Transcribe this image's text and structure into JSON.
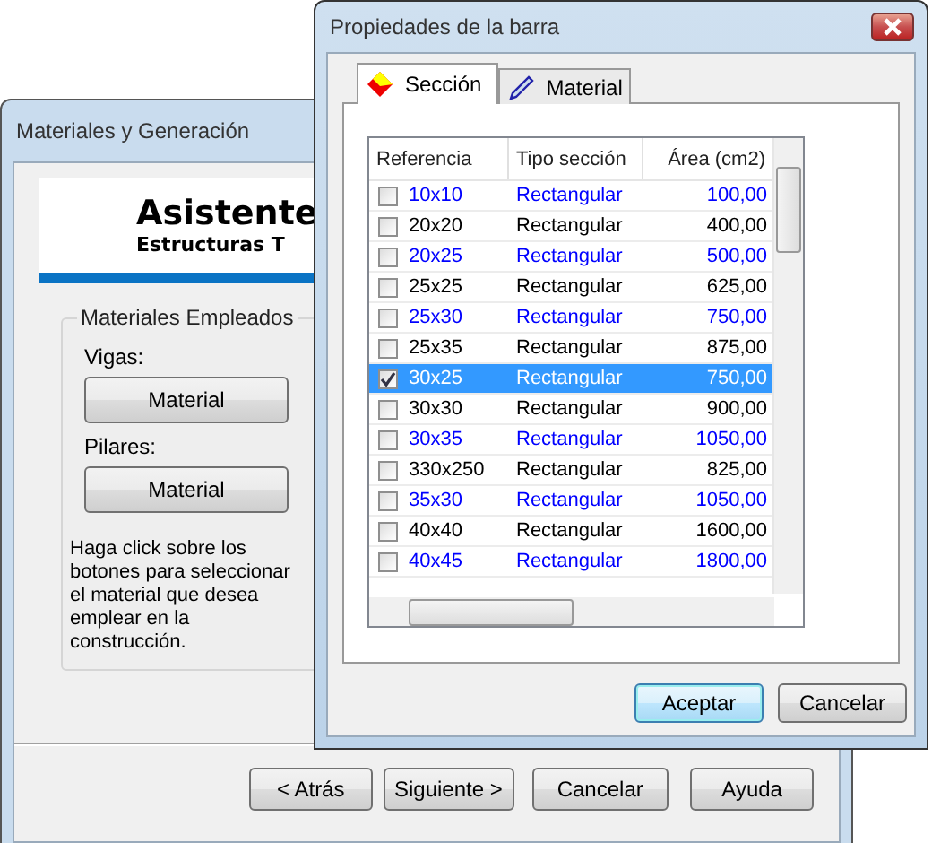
{
  "back_window": {
    "title": "Materiales y Generación",
    "banner": {
      "title": "Asistente",
      "subtitle": "Estructuras T"
    },
    "group": {
      "label": "Materiales Empleados",
      "fields": [
        {
          "label": "Vigas:",
          "button": "Material"
        },
        {
          "label": "Pilares:",
          "button": "Material"
        }
      ],
      "hint": "Haga click sobre los botones para seleccionar el material que desea emplear en la construcción."
    },
    "buttons": [
      {
        "label": "< Atrás",
        "default": false
      },
      {
        "label": "Siguiente >",
        "default": false
      },
      {
        "label": "Cancelar",
        "default": false
      },
      {
        "label": "Ayuda",
        "default": false
      }
    ]
  },
  "dialog": {
    "title": "Propiedades de la barra",
    "tabs": [
      {
        "label": "Sección",
        "selected": true,
        "kind": "section"
      },
      {
        "label": "Material",
        "selected": false,
        "kind": "material"
      }
    ],
    "table": {
      "columns": [
        "Referencia",
        "Tipo sección",
        "Área (cm2)"
      ],
      "rows": [
        {
          "ref": "10x10",
          "type": "Rectangular",
          "area": "100,00",
          "checked": false,
          "selected": false,
          "color": "#0000ff"
        },
        {
          "ref": "20x20",
          "type": "Rectangular",
          "area": "400,00",
          "checked": false,
          "selected": false,
          "color": "#000000"
        },
        {
          "ref": "20x25",
          "type": "Rectangular",
          "area": "500,00",
          "checked": false,
          "selected": false,
          "color": "#0000ff"
        },
        {
          "ref": "25x25",
          "type": "Rectangular",
          "area": "625,00",
          "checked": false,
          "selected": false,
          "color": "#000000"
        },
        {
          "ref": "25x30",
          "type": "Rectangular",
          "area": "750,00",
          "checked": false,
          "selected": false,
          "color": "#0000ff"
        },
        {
          "ref": "25x35",
          "type": "Rectangular",
          "area": "875,00",
          "checked": false,
          "selected": false,
          "color": "#000000"
        },
        {
          "ref": "30x25",
          "type": "Rectangular",
          "area": "750,00",
          "checked": true,
          "selected": true
        },
        {
          "ref": "30x30",
          "type": "Rectangular",
          "area": "900,00",
          "checked": false,
          "selected": false,
          "color": "#000000"
        },
        {
          "ref": "30x35",
          "type": "Rectangular",
          "area": "1050,00",
          "checked": false,
          "selected": false,
          "color": "#0000ff"
        },
        {
          "ref": "330x250",
          "type": "Rectangular",
          "area": "825,00",
          "checked": false,
          "selected": false,
          "color": "#000000"
        },
        {
          "ref": "35x30",
          "type": "Rectangular",
          "area": "1050,00",
          "checked": false,
          "selected": false,
          "color": "#0000ff"
        },
        {
          "ref": "40x40",
          "type": "Rectangular",
          "area": "1600,00",
          "checked": false,
          "selected": false,
          "color": "#000000"
        },
        {
          "ref": "40x45",
          "type": "Rectangular",
          "area": "1800,00",
          "checked": false,
          "selected": false,
          "color": "#0000ff"
        }
      ]
    },
    "buttons": [
      {
        "label": "Aceptar",
        "default": true
      },
      {
        "label": "Cancelar",
        "default": false
      }
    ]
  }
}
